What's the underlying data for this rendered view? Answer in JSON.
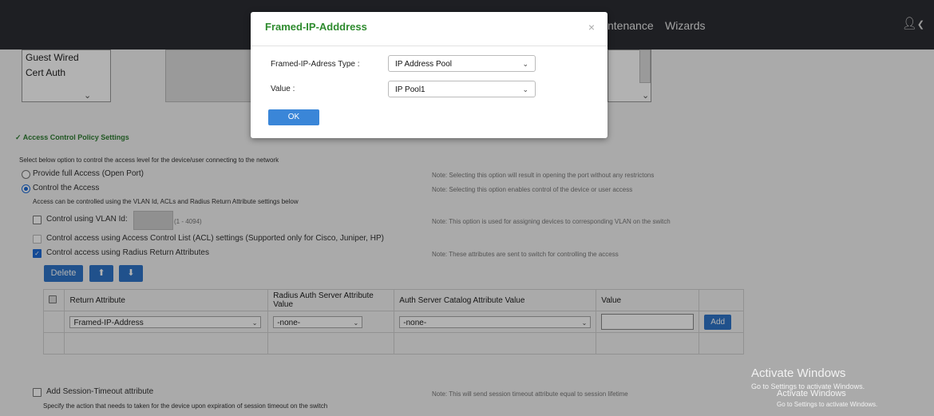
{
  "nav": {
    "maintenance_partial": "ntenance",
    "wizards": "Wizards",
    "user_icon": "user-icon",
    "chevron_icon": "chevron-down-icon"
  },
  "top_list": {
    "items": [
      "Guest Wired",
      "Cert Auth"
    ]
  },
  "section": {
    "title": "Access Control Policy Settings",
    "collapse_icon": "chevron-down-icon"
  },
  "access": {
    "intro": "Select below option to control the access level for the device/user connecting to the network",
    "option_open": "Provide full Access (Open Port)",
    "option_open_note": "Note: Selecting this option will result in opening the port without any restrictons",
    "option_control": "Control the Access",
    "option_control_note": "Note: Selecting this option enables control of the device or user access",
    "control_desc": "Access can be controlled using the VLAN Id, ACLs and Radius Return Attribute settings below",
    "vlan_label": "Control using VLAN Id:",
    "vlan_range": "(1 - 4094)",
    "vlan_note": "Note: This option is used for assigning devices to corresponding VLAN on the switch",
    "acl_label": "Control access using Access Control List (ACL) settings (Supported only for Cisco, Juniper, HP)",
    "radius_label": "Control access using Radius Return Attributes",
    "radius_note": "Note: These attributes are sent to switch for controlling the access"
  },
  "toolbar": {
    "delete_label": "Delete",
    "up_icon": "arrow-up-icon",
    "down_icon": "arrow-down-icon"
  },
  "table": {
    "headers": [
      "Return Attribute",
      "Radius Auth Server Attribute Value",
      "Auth Server Catalog Attribute Value",
      "Value"
    ],
    "row": {
      "return_attribute": "Framed-IP-Address",
      "radius_value": "-none-",
      "catalog_value": "-none-",
      "value": "",
      "add_label": "Add"
    }
  },
  "session": {
    "label": "Add Session-Timeout attribute",
    "note": "Note: This will send session timeout attribute equal to session lifetime",
    "desc": "Specify the action that needs to taken for the device upon expiration of session timeout on the switch"
  },
  "watermark": {
    "title1": "Activate Windows",
    "sub1": "Go to Settings to activate Windows.",
    "title2": "Activate Windows",
    "sub2": "Go to Settings to activate Windows."
  },
  "modal": {
    "title": "Framed-IP-Adddress",
    "close_icon": "close-icon",
    "type_label": "Framed-IP-Adress Type :",
    "type_value": "IP Address Pool",
    "value_label": "Value :",
    "value_value": "IP Pool1",
    "ok_label": "OK"
  }
}
